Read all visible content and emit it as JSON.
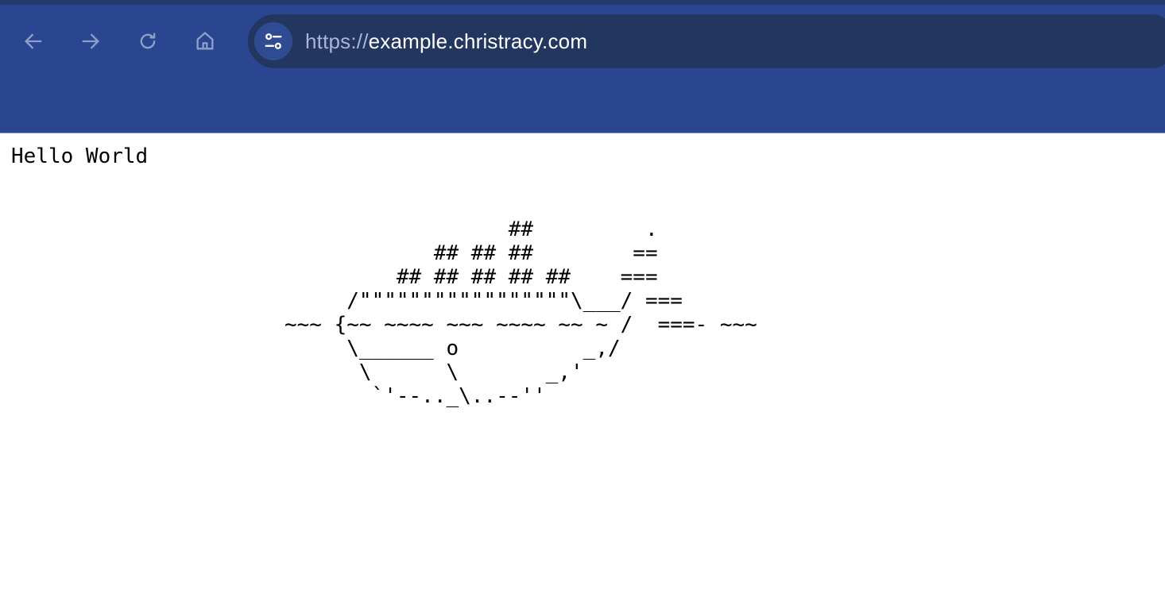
{
  "browser": {
    "url_scheme": "https://",
    "url_host": "example.christracy.com",
    "icon_color": "#8fa0c8",
    "chrome_color": "#2a4690",
    "icons": {
      "back": "arrow-left-icon",
      "forward": "arrow-right-icon",
      "reload": "reload-icon",
      "home": "home-icon",
      "site_info": "tune-icon"
    }
  },
  "page": {
    "heading": "Hello World",
    "ascii_art": "                  ##         .\n            ## ## ##        ==\n         ## ## ## ## ##    ===\n     /\"\"\"\"\"\"\"\"\"\"\"\"\"\"\"\"\"\\___/ ===\n~~~ {~~ ~~~~ ~~~ ~~~~ ~~ ~ /  ===- ~~~\n     \\______ o          _,/\n      \\      \\       _,'\n       `'--.._\\..--''"
  }
}
